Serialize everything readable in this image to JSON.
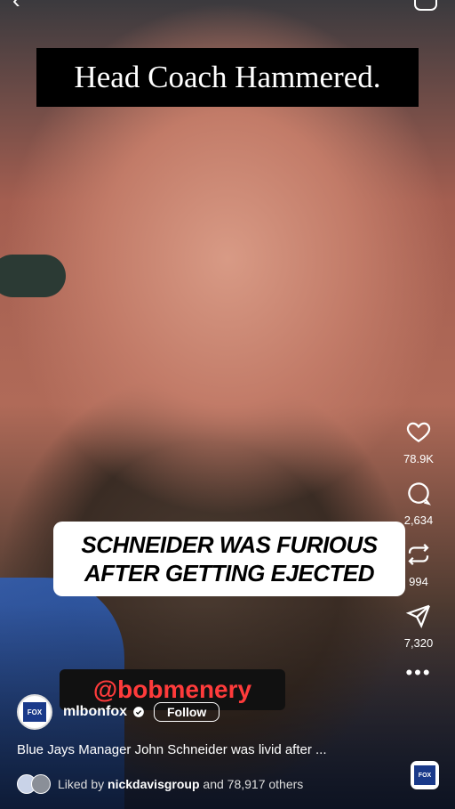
{
  "overlay": {
    "title": "Head Coach Hammered.",
    "caption_line1": "SCHNEIDER WAS FURIOUS",
    "caption_line2": "AFTER GETTING EJECTED",
    "handle": "@bobmenery"
  },
  "actions": {
    "like_count": "78.9K",
    "comment_count": "2,634",
    "repost_count": "994",
    "share_count": "7,320"
  },
  "account": {
    "username": "mlbonfox",
    "follow_label": "Follow",
    "avatar_text": "FOX"
  },
  "post": {
    "description": "Blue Jays Manager John Schneider was livid after ...",
    "liked_by_prefix": "Liked by ",
    "liked_by_user": "nickdavisgroup",
    "liked_by_suffix": " and 78,917 others"
  },
  "audio": {
    "thumb_text": "FOX"
  },
  "icons": {
    "back": "chevron-left-icon",
    "camera": "camera-icon",
    "like": "heart-icon",
    "comment": "comment-icon",
    "repost": "repost-icon",
    "share": "send-icon",
    "more": "more-dots-icon",
    "verified": "verified-badge-icon"
  },
  "colors": {
    "handle_text": "#ff3b3b",
    "title_bg": "#000000",
    "caption_bg": "#ffffff"
  }
}
